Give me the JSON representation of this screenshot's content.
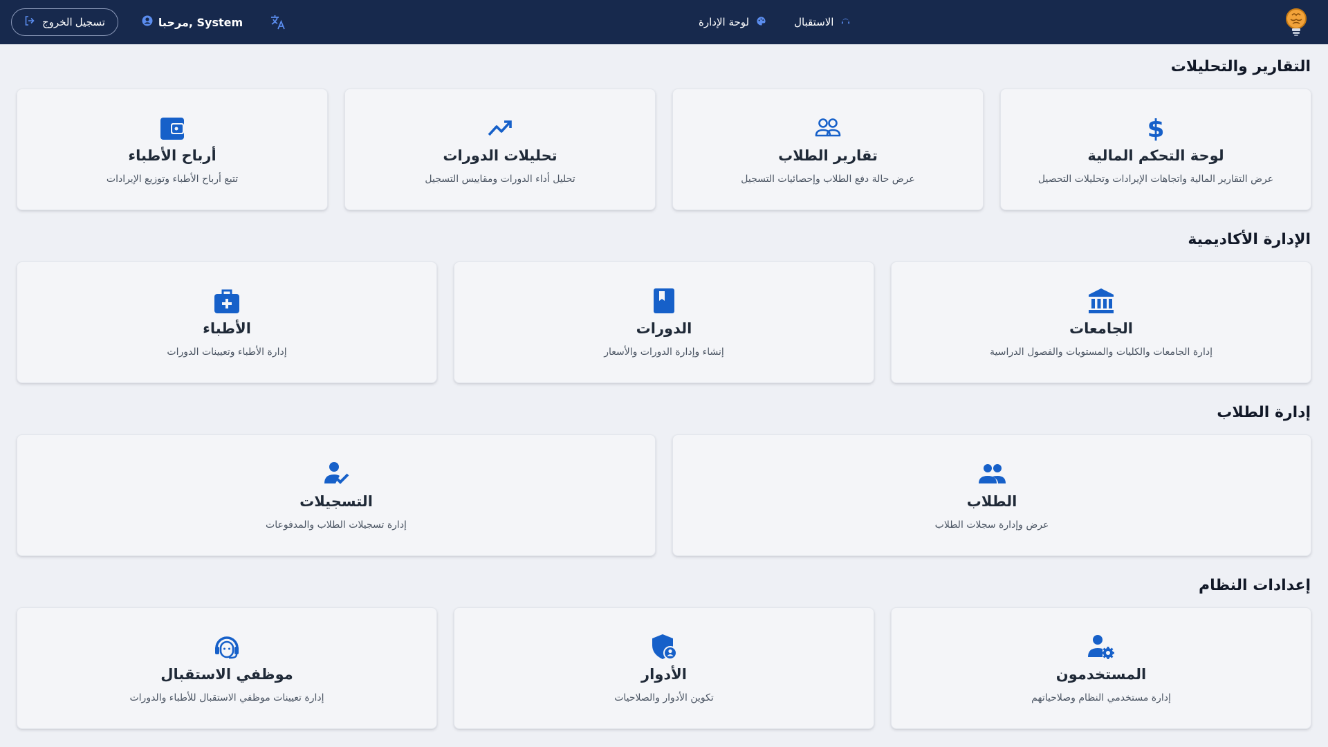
{
  "topbar": {
    "nav": [
      {
        "label": "الاستقبال",
        "icon": "reception-icon"
      },
      {
        "label": "لوحة الإدارة",
        "icon": "palette-icon"
      }
    ],
    "welcome_text": "مرحبا, System",
    "logout_label": "تسجيل الخروج",
    "logo": "brain-bulb-logo"
  },
  "sections": [
    {
      "title": "التقارير والتحليلات",
      "cards": [
        {
          "title": "لوحة التحكم المالية",
          "desc": "عرض التقارير المالية واتجاهات الإيرادات وتحليلات التحصيل",
          "icon": "dollar-icon"
        },
        {
          "title": "تقارير الطلاب",
          "desc": "عرض حالة دفع الطلاب وإحصائيات التسجيل",
          "icon": "people-outline-icon"
        },
        {
          "title": "تحليلات الدورات",
          "desc": "تحليل أداء الدورات ومقاييس التسجيل",
          "icon": "trending-up-icon"
        },
        {
          "title": "أرباح الأطباء",
          "desc": "تتبع أرباح الأطباء وتوزيع الإيرادات",
          "icon": "wallet-icon"
        }
      ]
    },
    {
      "title": "الإدارة الأكاديمية",
      "cards": [
        {
          "title": "الجامعات",
          "desc": "إدارة الجامعات والكليات والمستويات والفصول الدراسية",
          "icon": "institution-icon"
        },
        {
          "title": "الدورات",
          "desc": "إنشاء وإدارة الدورات والأسعار",
          "icon": "book-icon"
        },
        {
          "title": "الأطباء",
          "desc": "إدارة الأطباء وتعيينات الدورات",
          "icon": "medical-bag-icon"
        }
      ]
    },
    {
      "title": "إدارة الطلاب",
      "cards": [
        {
          "title": "الطلاب",
          "desc": "عرض وإدارة سجلات الطلاب",
          "icon": "people-icon"
        },
        {
          "title": "التسجيلات",
          "desc": "إدارة تسجيلات الطلاب والمدفوعات",
          "icon": "person-check-icon"
        }
      ]
    },
    {
      "title": "إعدادات النظام",
      "cards": [
        {
          "title": "المستخدمون",
          "desc": "إدارة مستخدمي النظام وصلاحياتهم",
          "icon": "user-gear-icon"
        },
        {
          "title": "الأدوار",
          "desc": "تكوين الأدوار والصلاحيات",
          "icon": "shield-user-icon"
        },
        {
          "title": "موظفي الاستقبال",
          "desc": "إدارة تعيينات موظفي الاستقبال للأطباء والدورات",
          "icon": "headset-icon"
        }
      ]
    }
  ],
  "colors": {
    "topbar": "#17294d",
    "accent": "#1660c9",
    "background": "#eef0f5"
  }
}
